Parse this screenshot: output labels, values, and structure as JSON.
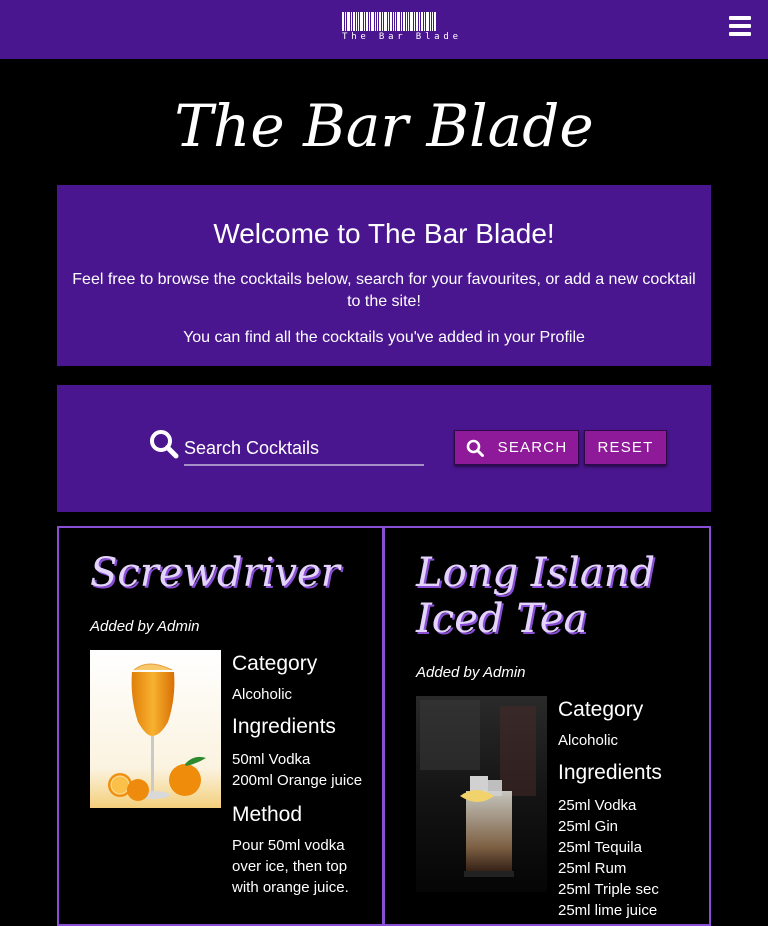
{
  "navbar": {
    "logo_text": "The Bar Blade",
    "menu_icon": "hamburger-menu-icon"
  },
  "page_title": "The Bar Blade",
  "welcome": {
    "heading": "Welcome to The Bar Blade!",
    "text1": "Feel free to browse the cocktails below, search for your favourites, or add a new cocktail to the site!",
    "text2": "You can find all the cocktails you've added in your Profile"
  },
  "search": {
    "placeholder": "Search Cocktails",
    "search_label": "SEARCH",
    "reset_label": "RESET",
    "icon": "search-icon"
  },
  "colors": {
    "primary": "#4a168f",
    "button": "#8f1a99",
    "card_border": "#8a4ed6"
  },
  "cocktails": [
    {
      "name": "Screwdriver",
      "added_by": "Added by Admin",
      "category_heading": "Category",
      "category": "Alcoholic",
      "ingredients_heading": "Ingredients",
      "ingredients": [
        "50ml Vodka",
        "200ml Orange juice"
      ],
      "method_heading": "Method",
      "method": "Pour 50ml vodka over ice, then top with orange juice."
    },
    {
      "name": "Long Island Iced Tea",
      "added_by": "Added by Admin",
      "category_heading": "Category",
      "category": "Alcoholic",
      "ingredients_heading": "Ingredients",
      "ingredients": [
        "25ml Vodka",
        "25ml Gin",
        "25ml Tequila",
        "25ml Rum",
        "25ml Triple sec",
        "25ml lime juice"
      ]
    }
  ]
}
